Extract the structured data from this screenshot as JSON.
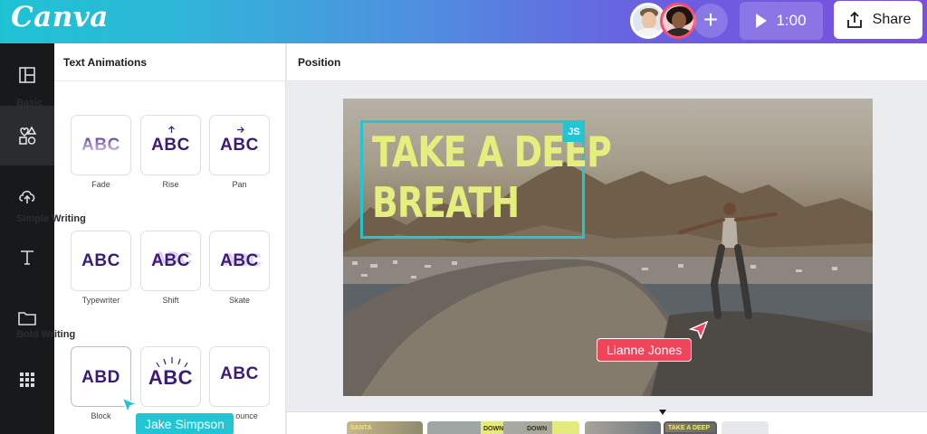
{
  "app": {
    "logo": "Canva"
  },
  "topbar": {
    "play_label": "1:00",
    "share_label": "Share",
    "add_symbol": "+"
  },
  "panel": {
    "title": "Text Animations",
    "sections": [
      {
        "title": "Basic",
        "items": [
          {
            "label": "Fade",
            "sample": "ABC"
          },
          {
            "label": "Rise",
            "sample": "ABC"
          },
          {
            "label": "Pan",
            "sample": "ABC"
          }
        ]
      },
      {
        "title": "Simple Writing",
        "items": [
          {
            "label": "Typewriter",
            "sample": "ABC"
          },
          {
            "label": "Shift",
            "sample": "ABC"
          },
          {
            "label": "Skate",
            "sample": "ABC"
          }
        ]
      },
      {
        "title": "Bold Writing",
        "items": [
          {
            "label": "Block",
            "sample": "ABD"
          },
          {
            "label": "",
            "sample": "ABC"
          },
          {
            "label": "ounce",
            "sample": "ABC"
          }
        ]
      }
    ]
  },
  "editor": {
    "header": "Position",
    "headline_line1": "TAKE A DEEP",
    "headline_line2": "BREATH",
    "badge": "JS"
  },
  "cursors": {
    "lianne": {
      "name": "Lianne Jones",
      "color": "#f0445a"
    },
    "jake": {
      "name": "Jake Simpson",
      "color": "#23c4d4"
    }
  },
  "timeline": {
    "clips": [
      {
        "label": "SANTA"
      },
      {
        "label": "DOWN"
      },
      {
        "label": "DOWN"
      },
      {
        "label": ""
      },
      {
        "label": "TAKE A DEEP"
      }
    ]
  },
  "colors": {
    "accent": "#23c4d4",
    "headline": "#e5ef7d",
    "ink": "#3c1a78"
  }
}
